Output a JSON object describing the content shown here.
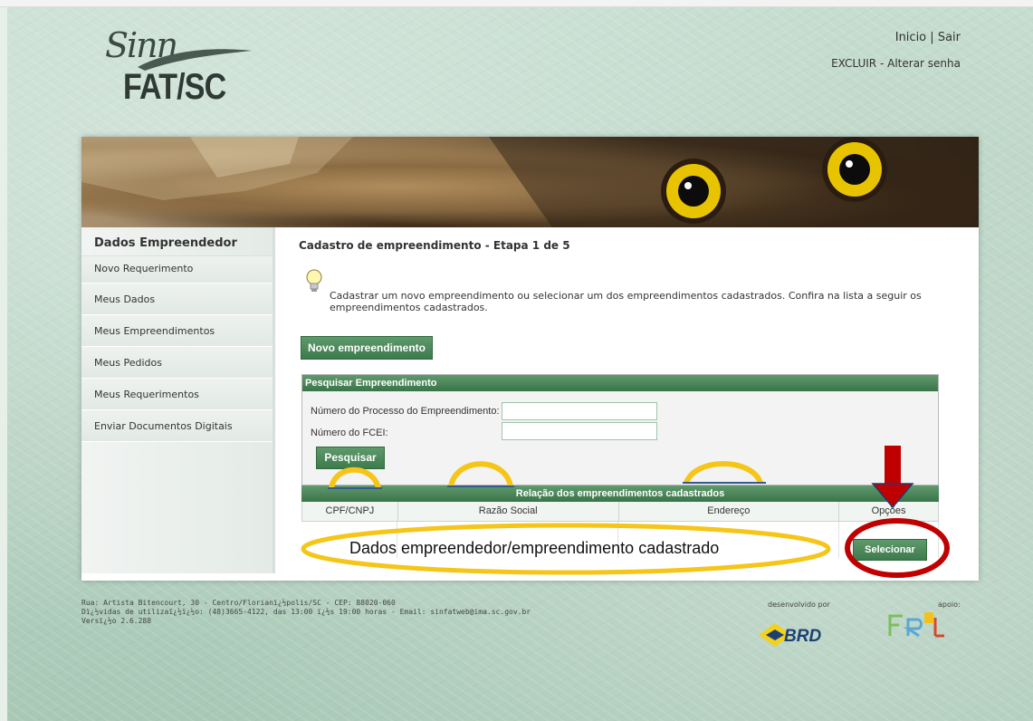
{
  "header": {
    "logo_script": "Sinn",
    "logo_main": "FAT/SC",
    "link_inicio": "Inicio",
    "separator": "|",
    "link_sair": "Sair",
    "link_excluir": "EXCLUIR",
    "dash": "-",
    "link_alterar_senha": "Alterar senha"
  },
  "sidebar": {
    "title": "Dados Empreendedor",
    "items": [
      {
        "label": "Novo Requerimento"
      },
      {
        "label": "Meus Dados"
      },
      {
        "label": "Meus Empreendimentos"
      },
      {
        "label": "Meus Pedidos"
      },
      {
        "label": "Meus Requerimentos"
      },
      {
        "label": "Enviar Documentos Digitais"
      }
    ]
  },
  "main": {
    "title": "Cadastro de empreendimento - Etapa 1 de 5",
    "intro": "Cadastrar um novo empreendimento ou selecionar um dos empreendimentos cadastrados. Confira na lista a seguir os empreendimentos cadastrados.",
    "new_button": "Novo empreendimento",
    "search": {
      "title": "Pesquisar Empreendimento",
      "label_processo": "Número do Processo do Empreendimento:",
      "label_fcei": "Número do FCEI:",
      "value_processo": "",
      "value_fcei": "",
      "button": "Pesquisar"
    },
    "results": {
      "title": "Relação dos empreendimentos cadastrados",
      "columns": [
        "CPF/CNPJ",
        "Razão Social",
        "Endereço",
        "Opções"
      ],
      "select_button": "Selecionar"
    }
  },
  "annotations": {
    "oval_text": "Dados empreendedor/empreendimento cadastrado",
    "color_yellow": "#f5c518",
    "color_red": "#c00000"
  },
  "footer": {
    "line1": "Rua: Artista Bitencourt, 30 - Centro/Florianï¿½polis/SC - CEP: 88020-060",
    "line2": "Dï¿½vidas de utilizaï¿½ï¿½o: (48)3665-4122, das 13:00 ï¿½s 19:00 horas - Email: sinfatweb@ima.sc.gov.br",
    "line3": "Versï¿½o 2.6.288",
    "developed_by": "desenvolvido por",
    "support": "apoio:",
    "brd": "BRD"
  },
  "colors": {
    "accent_green": "#3d7a4c",
    "page_bg": "#b8d3c4"
  }
}
